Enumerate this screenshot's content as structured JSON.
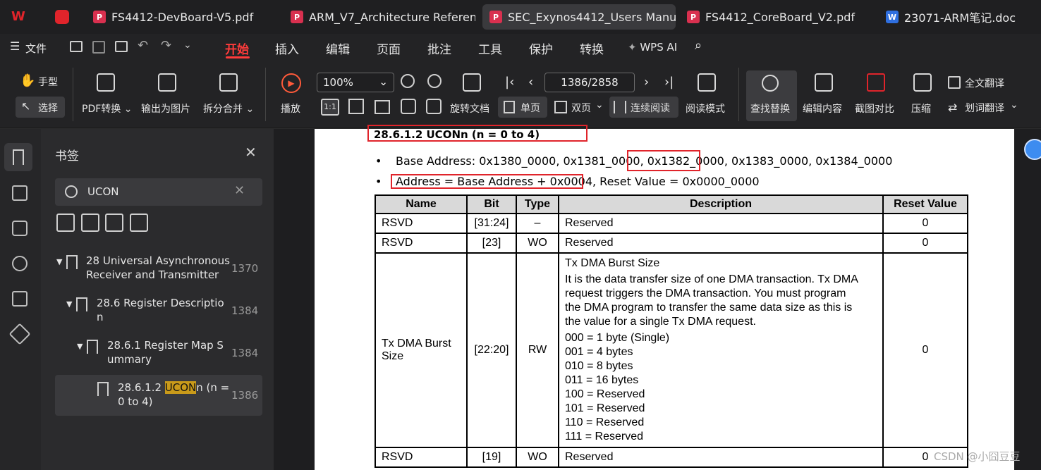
{
  "tabs": [
    {
      "label": "FS4412-DevBoard-V5.pdf",
      "type": "pdf"
    },
    {
      "label": "ARM_V7_Architecture Referenc",
      "type": "pdf"
    },
    {
      "label": "SEC_Exynos4412_Users Manu",
      "type": "pdf"
    },
    {
      "label": "FS4412_CoreBoard_V2.pdf",
      "type": "pdf"
    },
    {
      "label": "23071-ARM笔记.doc",
      "type": "doc"
    }
  ],
  "menu": {
    "file": "文件",
    "items": [
      "开始",
      "插入",
      "编辑",
      "页面",
      "批注",
      "工具",
      "保护",
      "转换"
    ],
    "ai": "WPS AI"
  },
  "toolbar": {
    "hand": "手型",
    "select": "选择",
    "pdf_convert": "PDF转换",
    "export_image": "输出为图片",
    "split_merge": "拆分合并",
    "play": "播放",
    "zoom": "100%",
    "rotate": "旋转文档",
    "page_box": "1386/2858",
    "single": "单页",
    "double": "双页",
    "continuous": "连续阅读",
    "read_mode": "阅读模式",
    "find_replace": "查找替换",
    "edit_content": "编辑内容",
    "screenshot_compare": "截图对比",
    "compress": "压缩",
    "full_translate": "全文翻译",
    "word_translate": "划词翻译"
  },
  "sidebar": {
    "title": "书签",
    "search_value": "UCON",
    "items": [
      {
        "line1": "28 Universal Asynchronous",
        "line2": "Receiver and Transmitter",
        "page": "1370"
      },
      {
        "line1": "28.6 Register Descriptio",
        "line2": "n",
        "page": "1384"
      },
      {
        "line1": "28.6.1 Register Map S",
        "line2": "ummary",
        "page": "1384"
      },
      {
        "pre": "28.6.1.2 ",
        "match": "UCON",
        "post": "n (n =",
        "line2": "0 to 4)",
        "page": "1386"
      }
    ]
  },
  "document": {
    "heading": "28.6.1.2 UCONn (n = 0 to 4)",
    "base_prefix": "Base Address: 0x1380_0000, 0x1381_0000, ",
    "base_highlight": "0x1382_0000",
    "base_suffix": ", 0x1383_0000, 0x1384_0000",
    "address_highlight": "Address = Base Address + 0x0004,",
    "reset_text": " Reset Value = 0x0000_0000",
    "table": {
      "headers": [
        "Name",
        "Bit",
        "Type",
        "Description",
        "Reset Value"
      ],
      "rows": [
        {
          "name": "RSVD",
          "bit": "[31:24]",
          "type": "–",
          "desc": [
            "Reserved"
          ],
          "reset": "0"
        },
        {
          "name": "RSVD",
          "bit": "[23]",
          "type": "WO",
          "desc": [
            "Reserved"
          ],
          "reset": "0"
        },
        {
          "name": "Tx DMA Burst Size",
          "bit": "[22:20]",
          "type": "RW",
          "desc": [
            "Tx DMA Burst Size",
            "It is the data transfer size of one DMA transaction. Tx DMA",
            "request triggers the DMA transaction. You must program",
            "the DMA program to transfer the same data size as this is",
            "the value for a single Tx DMA request.",
            "000 = 1 byte (Single)",
            "001 = 4 bytes",
            "010 = 8 bytes",
            "011 = 16 bytes",
            "100 = Reserved",
            "101 = Reserved",
            "110 = Reserved",
            "111 = Reserved"
          ],
          "reset": "0"
        },
        {
          "name": "RSVD",
          "bit": "[19]",
          "type": "WO",
          "desc": [
            "Reserved"
          ],
          "reset": "0"
        }
      ]
    }
  },
  "watermark": "CSDN @小囧豆豆"
}
